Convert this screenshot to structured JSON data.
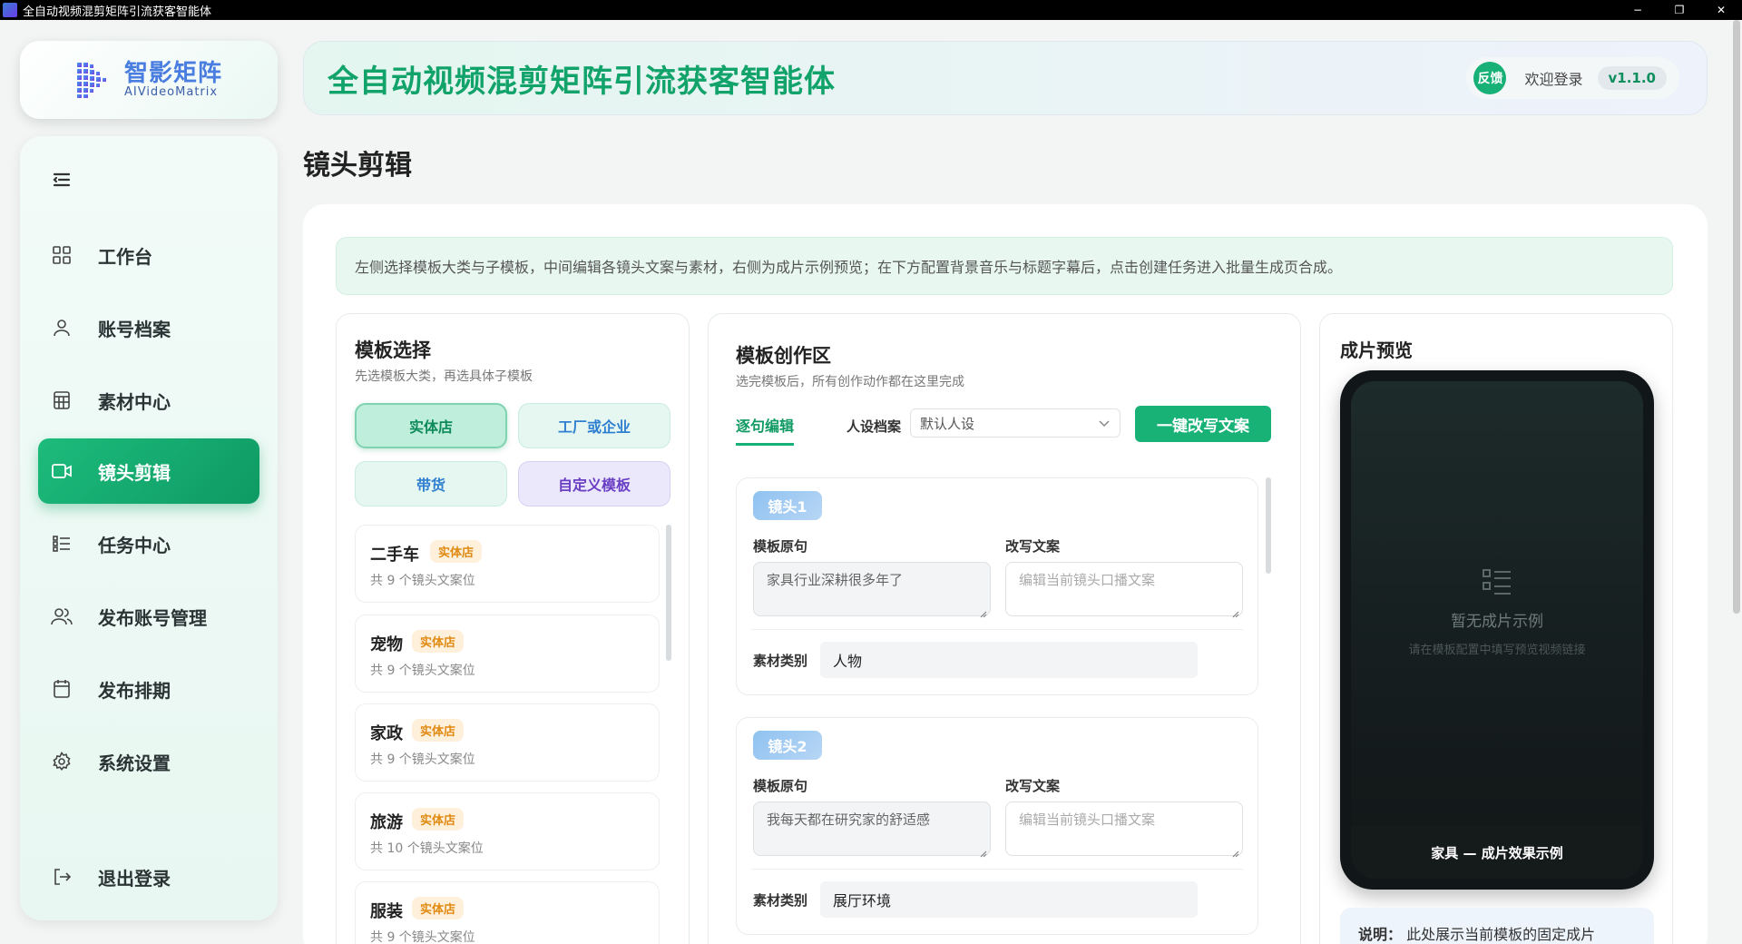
{
  "window": {
    "title": "全自动视频混剪矩阵引流获客智能体",
    "minimize": "−",
    "maximize": "❐",
    "close": "✕"
  },
  "logo": {
    "cn": "智影矩阵",
    "en": "AIVideoMatrix"
  },
  "sidebar": {
    "items": [
      {
        "label": "工作台",
        "icon": "grid-icon"
      },
      {
        "label": "账号档案",
        "icon": "user-icon"
      },
      {
        "label": "素材中心",
        "icon": "calculator-icon"
      },
      {
        "label": "镜头剪辑",
        "icon": "video-camera-icon",
        "active": true
      },
      {
        "label": "任务中心",
        "icon": "list-icon"
      },
      {
        "label": "发布账号管理",
        "icon": "users-icon"
      },
      {
        "label": "发布排期",
        "icon": "calendar-icon"
      },
      {
        "label": "系统设置",
        "icon": "gear-icon"
      }
    ],
    "logout": "退出登录"
  },
  "header": {
    "title": "全自动视频混剪矩阵引流获客智能体",
    "feedback": "反馈",
    "welcome": "欢迎登录",
    "version": "v1.1.0"
  },
  "page": {
    "title": "镜头剪辑",
    "tip": "左侧选择模板大类与子模板，中间编辑各镜头文案与素材，右侧为成片示例预览；在下方配置背景音乐与标题字幕后，点击创建任务进入批量生成页合成。"
  },
  "template_panel": {
    "title": "模板选择",
    "subtitle": "先选模板大类，再选具体子模板",
    "categories": [
      "实体店",
      "工厂或企业",
      "带货",
      "自定义模板"
    ],
    "items": [
      {
        "name": "二手车",
        "badge": "实体店",
        "count": "共 9 个镜头文案位"
      },
      {
        "name": "宠物",
        "badge": "实体店",
        "count": "共 9 个镜头文案位"
      },
      {
        "name": "家政",
        "badge": "实体店",
        "count": "共 9 个镜头文案位"
      },
      {
        "name": "旅游",
        "badge": "实体店",
        "count": "共 10 个镜头文案位"
      },
      {
        "name": "服装",
        "badge": "实体店",
        "count": "共 9 个镜头文案位"
      }
    ]
  },
  "editor": {
    "title": "模板创作区",
    "subtitle": "选完模板后，所有创作动作都在这里完成",
    "tab": "逐句编辑",
    "persona_label": "人设档案",
    "persona_value": "默认人设",
    "rewrite_button": "一键改写文案",
    "original_label": "模板原句",
    "rewrite_label": "改写文案",
    "rewrite_placeholder": "编辑当前镜头口播文案",
    "material_label": "素材类别",
    "shots": [
      {
        "badge": "镜头1",
        "original": "家具行业深耕很多年了",
        "material": "人物"
      },
      {
        "badge": "镜头2",
        "original": "我每天都在研究家的舒适感",
        "material": "展厅环境"
      }
    ]
  },
  "preview": {
    "title": "成片预览",
    "empty_title": "暂无成片示例",
    "empty_sub": "请在模板配置中填写预览视频链接",
    "caption": "家具 — 成片效果示例",
    "note_label": "说明：",
    "note_text": "此处展示当前模板的固定成片"
  },
  "colors": {
    "accent": "#17b177",
    "header_title": "#12a36b",
    "badge_bg": "#fff0dc",
    "badge_text": "#e08a12"
  }
}
